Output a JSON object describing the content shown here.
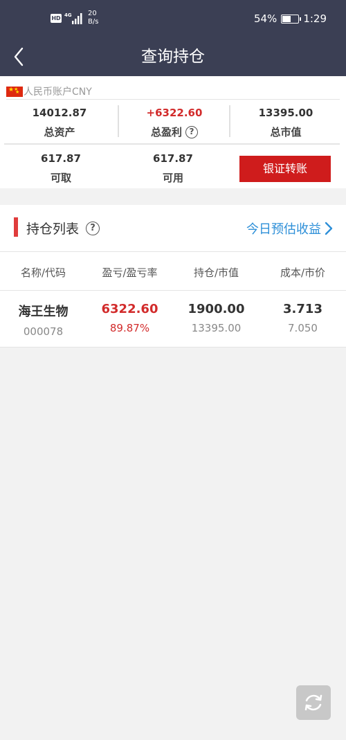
{
  "status_bar": {
    "hd": "HD",
    "network": "4G",
    "speed_value": "20",
    "speed_unit": "B/s",
    "battery_percent": "54%",
    "battery_level": 0.54,
    "time": "1:29"
  },
  "header": {
    "title": "查询持仓",
    "back_icon": "chevron-left-icon"
  },
  "account": {
    "label": "人民币账户CNY",
    "flag_icon": "china-flag-icon",
    "total_assets": {
      "value": "14012.87",
      "label": "总资产"
    },
    "total_profit": {
      "value": "+6322.60",
      "label": "总盈利",
      "help_icon": "question-icon"
    },
    "total_market_value": {
      "value": "13395.00",
      "label": "总市值"
    },
    "withdrawable": {
      "value": "617.87",
      "label": "可取"
    },
    "available": {
      "value": "617.87",
      "label": "可用"
    },
    "transfer_button": "银证转账"
  },
  "holdings": {
    "title": "持仓列表",
    "help_icon": "question-icon",
    "estimate_link": "今日预估收益",
    "columns": [
      "名称/代码",
      "盈亏/盈亏率",
      "持仓/市值",
      "成本/市价"
    ],
    "rows": [
      {
        "name": "海王生物",
        "code": "000078",
        "profit": "6322.60",
        "profit_rate": "89.87%",
        "position": "1900.00",
        "market_value": "13395.00",
        "cost": "3.713",
        "price": "7.050"
      }
    ]
  },
  "refresh_icon": "refresh-icon",
  "colors": {
    "header_bg": "#3b3f54",
    "accent_red": "#cf1c1c",
    "profit_red": "#d22b2b",
    "link_blue": "#2d8fd8"
  }
}
